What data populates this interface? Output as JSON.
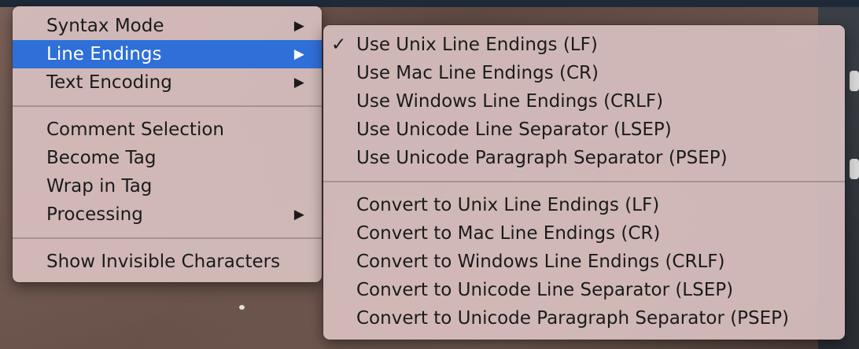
{
  "context_menu": {
    "groups": [
      [
        {
          "label": "Syntax Mode",
          "has_submenu": true,
          "highlighted": false
        },
        {
          "label": "Line Endings",
          "has_submenu": true,
          "highlighted": true
        },
        {
          "label": "Text Encoding",
          "has_submenu": true,
          "highlighted": false
        }
      ],
      [
        {
          "label": "Comment Selection",
          "has_submenu": false,
          "highlighted": false
        },
        {
          "label": "Become Tag",
          "has_submenu": false,
          "highlighted": false
        },
        {
          "label": "Wrap in Tag",
          "has_submenu": false,
          "highlighted": false
        },
        {
          "label": "Processing",
          "has_submenu": true,
          "highlighted": false
        }
      ],
      [
        {
          "label": "Show Invisible Characters",
          "has_submenu": false,
          "highlighted": false
        }
      ]
    ],
    "submenu_arrow": "▶"
  },
  "line_endings_submenu": {
    "checkmark": "✓",
    "groups": [
      [
        {
          "label": "Use Unix Line Endings (LF)",
          "checked": true
        },
        {
          "label": "Use Mac Line Endings (CR)",
          "checked": false
        },
        {
          "label": "Use Windows Line Endings (CRLF)",
          "checked": false
        },
        {
          "label": "Use Unicode Line Separator (LSEP)",
          "checked": false
        },
        {
          "label": "Use Unicode Paragraph Separator (PSEP)",
          "checked": false
        }
      ],
      [
        {
          "label": "Convert to Unix Line Endings (LF)",
          "checked": false
        },
        {
          "label": "Convert to Mac Line Endings (CR)",
          "checked": false
        },
        {
          "label": "Convert to Windows Line Endings (CRLF)",
          "checked": false
        },
        {
          "label": "Convert to Unicode Line Separator (LSEP)",
          "checked": false
        },
        {
          "label": "Convert to Unicode Paragraph Separator (PSEP)",
          "checked": false
        }
      ]
    ]
  },
  "colors": {
    "highlight": "#2f6fd8",
    "menu_background": "#d8c0c0",
    "text": "#1b1b1b"
  }
}
